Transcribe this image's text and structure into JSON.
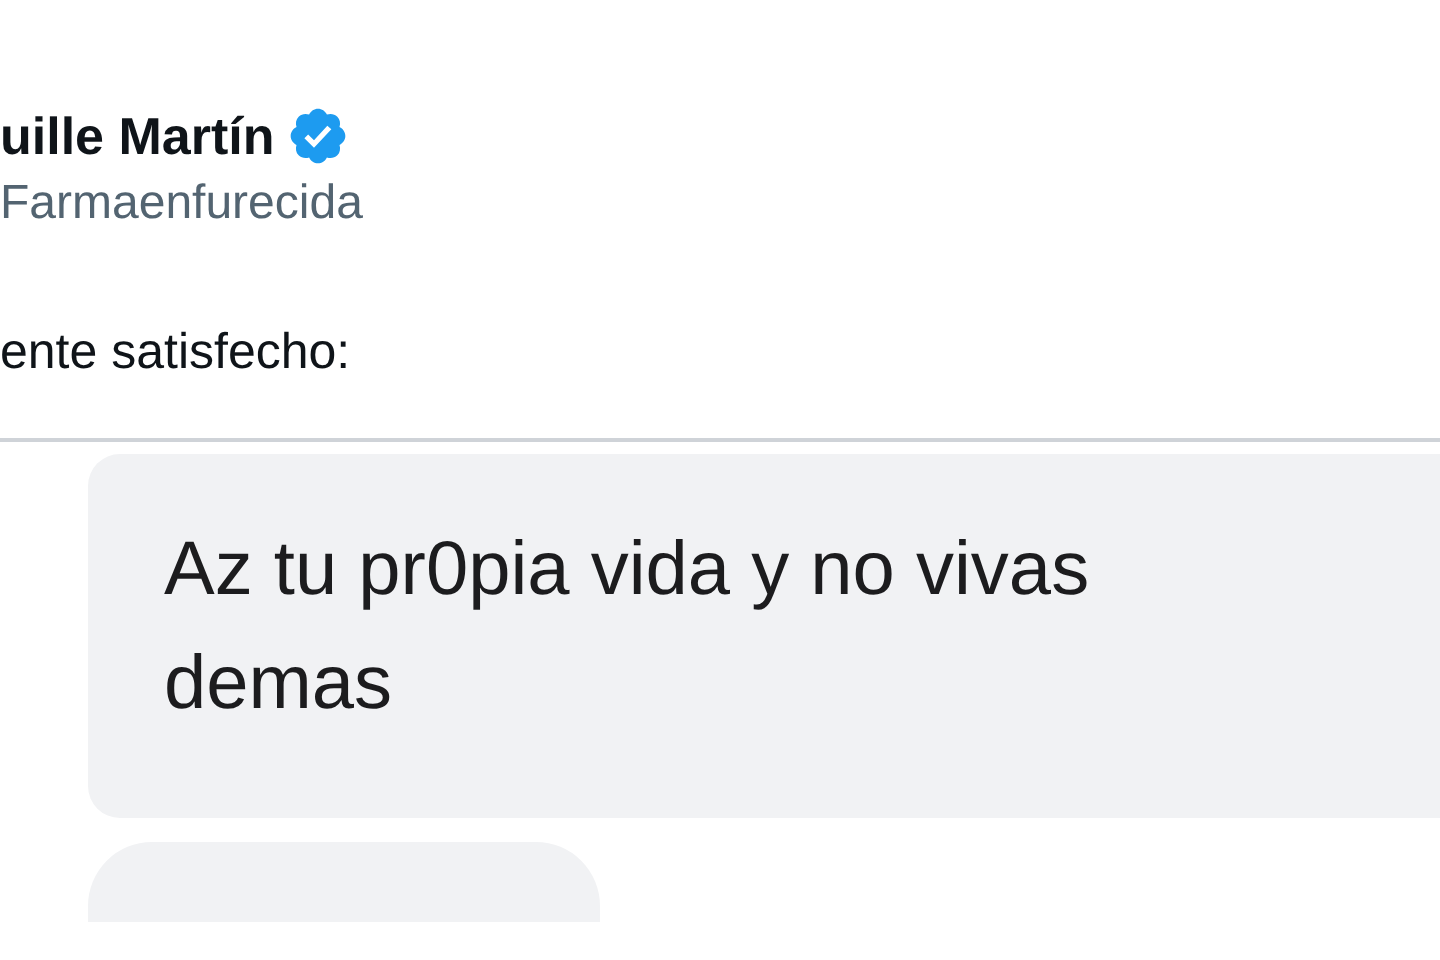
{
  "author": {
    "name": "uille Martín",
    "verified": true,
    "handle": "Farmaenfurecida"
  },
  "tweet_text": "ente satisfecho:",
  "messages": [
    {
      "kind": "text",
      "text": "Az tu pr0pia vida y no vivas demas"
    },
    {
      "kind": "empty"
    }
  ]
}
